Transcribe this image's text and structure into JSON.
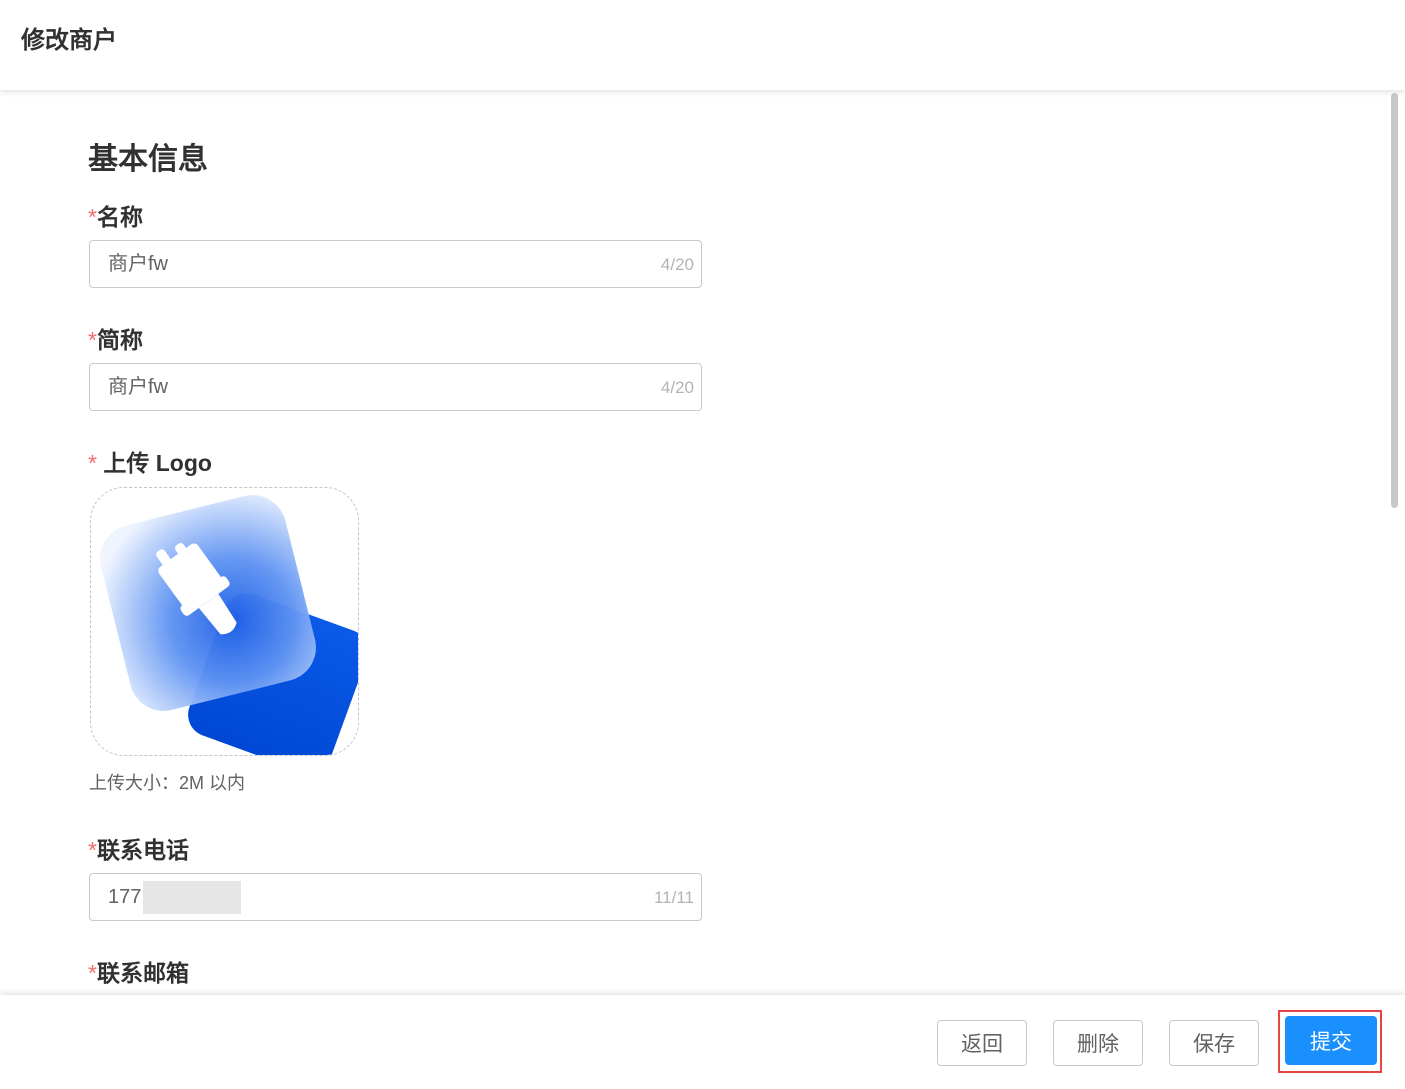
{
  "header": {
    "title": "修改商户"
  },
  "basic": {
    "section_title": "基本信息",
    "name": {
      "required_mark": "*",
      "label": "名称",
      "value": "商户fw",
      "count": "4/20"
    },
    "short_name": {
      "required_mark": "*",
      "label": "简称",
      "value": "商户fw",
      "count": "4/20"
    },
    "logo": {
      "required_mark": "*",
      "label": "上传 Logo",
      "hint": "上传大小：2M 以内",
      "icon": "paint-brush-logo-icon"
    },
    "phone": {
      "required_mark": "*",
      "label": "联系电话",
      "value": "177",
      "count": "11/11"
    },
    "email": {
      "required_mark": "*",
      "label": "联系邮箱"
    }
  },
  "footer": {
    "back_label": "返回",
    "delete_label": "删除",
    "save_label": "保存",
    "submit_label": "提交"
  },
  "colors": {
    "primary": "#1a90ff",
    "required": "#f56c6c",
    "highlight": "#e64545",
    "logo_blue": "#0055e0"
  }
}
